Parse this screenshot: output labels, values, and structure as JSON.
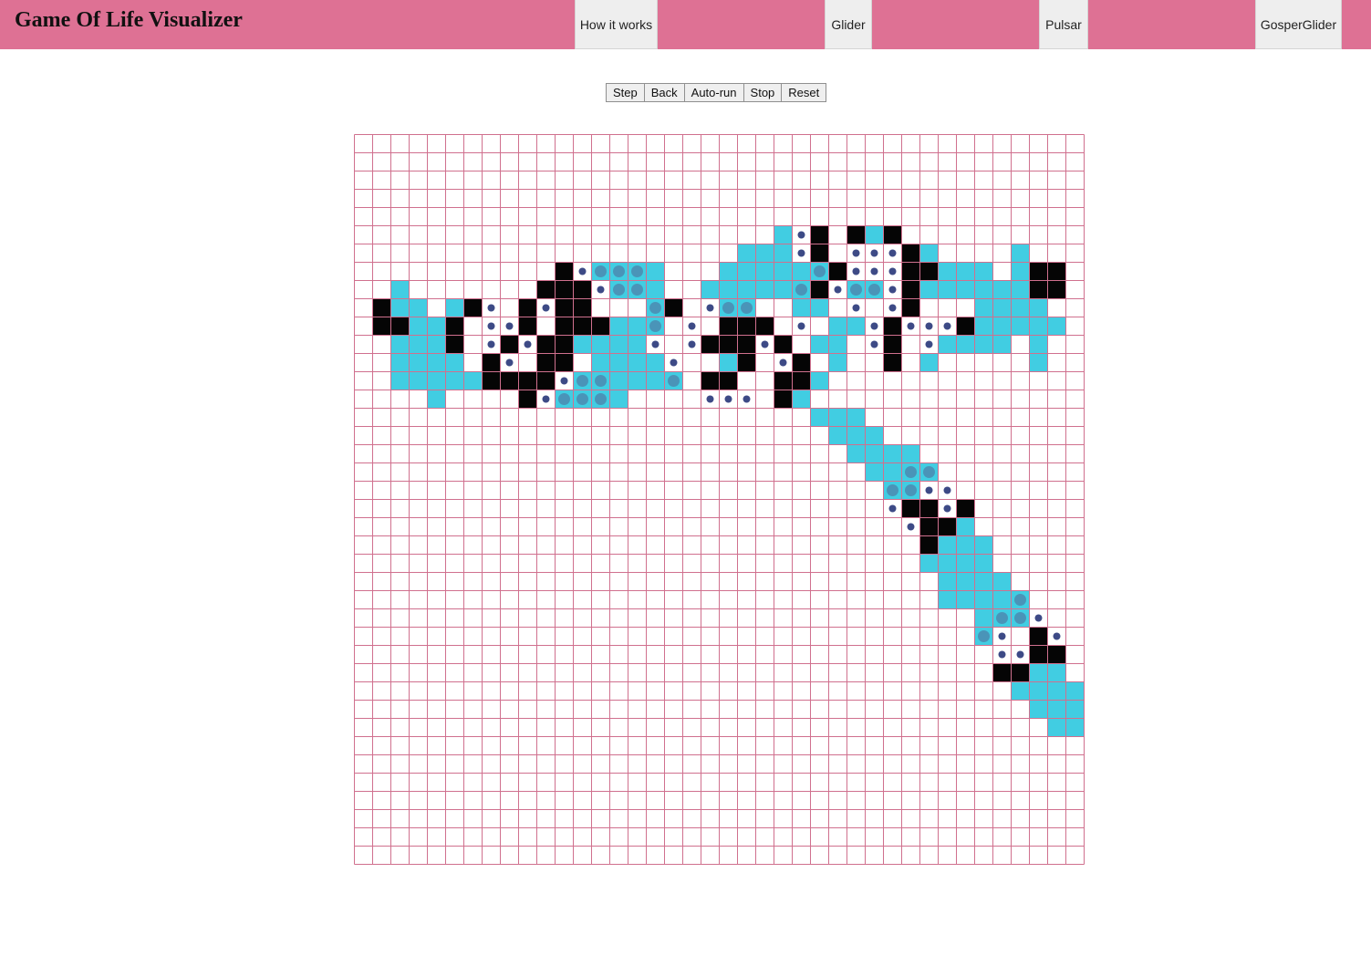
{
  "header": {
    "title": "Game Of Life Visualizer"
  },
  "nav": [
    {
      "label": "How it works"
    },
    {
      "label": "Glider"
    },
    {
      "label": "Pulsar"
    },
    {
      "label": "GosperGlider"
    }
  ],
  "controls": [
    {
      "label": "Step"
    },
    {
      "label": "Back"
    },
    {
      "label": "Auto-run"
    },
    {
      "label": "Stop"
    },
    {
      "label": "Reset"
    }
  ],
  "grid": {
    "rows": 40,
    "cols": 40,
    "colors": {
      "line": "#d0708e",
      "alive": "#050505",
      "visited": "#41cde2",
      "marker_large": "#4a94b8",
      "marker_dot": "#3d4a86"
    },
    "cells": [
      "........................................",
      "........................................",
      "........................................",
      "........................................",
      "........................................",
      ".......................CoB.#CB..........",
      ".....................CCCoB.oooBC....C...",
      "...........#oOOOC...CCCCCOBooo#BCCC.C##.",
      "..C.......##BoOOC..CCCCCOBoOOo#CCCCCC##.",
      ".#CC.C#o.#o#B...OB.oOO..CC.o.oB...CCCC..",
      ".##CCB.ooB.##BCCO.o.B#B.o.CCoBooo#CCCCC.",
      "..CCC#.o#o##CCCCo.oB#BoB.CC.oB.oCCCC.C..",
      "..CCCC.#o.#B.CCCCo..CB.oB.C..B.C.....C..",
      "..CCCCC####oOOCCCO.##..##C.............",
      "....C....BoOOOC....ooo.BC...............",
      ".........................CCC............",
      "..........................CCC...........",
      "...........................CCCC.........",
      "............................CCOO........",
      ".............................OOoo.......",
      ".............................oB#oB......",
      "..............................o##C......",
      "...............................#CCC.....",
      "...............................CCCC.....",
      "................................CCCC....",
      "................................CCCCO...",
      "..................................COOo..",
      "..................................Oo.#o.",
      "...................................oo##.",
      "...................................##CC.",
      "....................................CCCC",
      ".....................................CCC",
      "......................................CC",
      "........................................",
      "........................................",
      "........................................",
      "........................................",
      "........................................",
      "........................................",
      "........................................"
    ]
  }
}
